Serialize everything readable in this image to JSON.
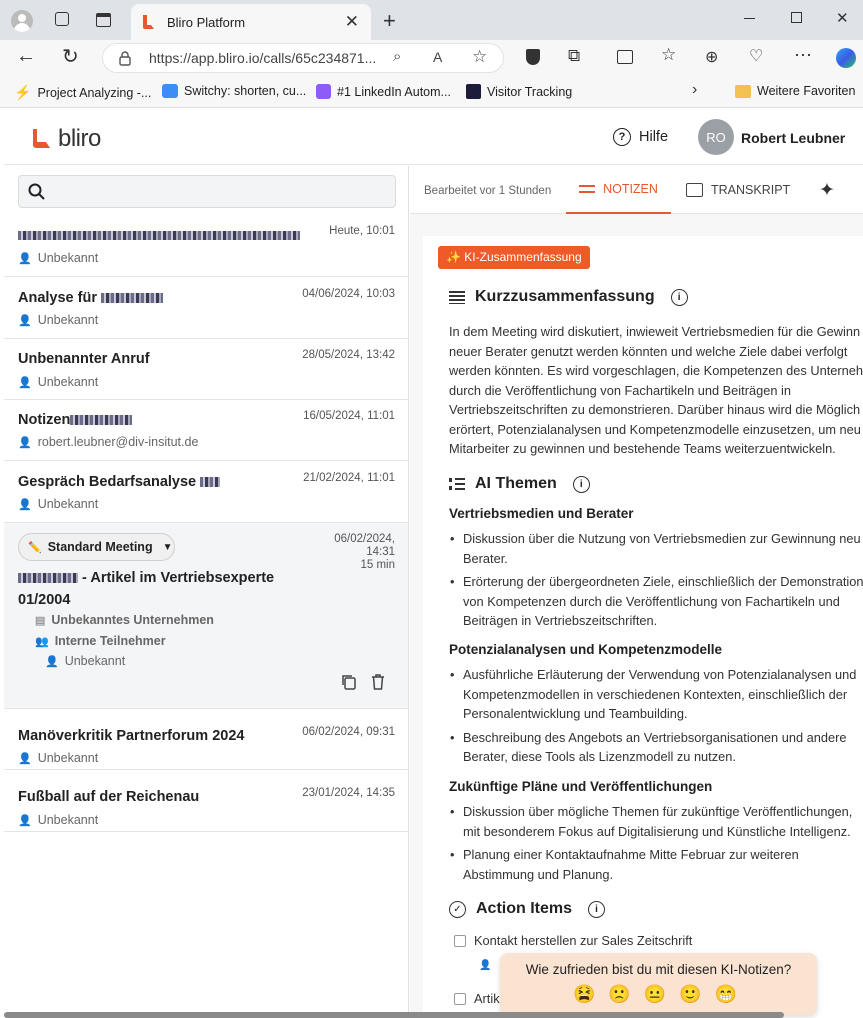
{
  "browser": {
    "tab_title": "Bliro Platform",
    "url": "https://app.bliro.io/calls/65c234871...",
    "bookmarks": [
      "Project Analyzing -...",
      "Switchy: shorten, cu...",
      "#1 LinkedIn Autom...",
      "Visitor Tracking",
      "Weitere Favoriten"
    ]
  },
  "header": {
    "logo": "bliro",
    "help": "Hilfe",
    "avatar_initials": "RO",
    "user_name": "Robert Leubner"
  },
  "calls": [
    {
      "title": "",
      "date": "Heute, 10:01",
      "sub": "Unbekannt"
    },
    {
      "title": "Analyse für",
      "date": "04/06/2024, 10:03",
      "sub": "Unbekannt"
    },
    {
      "title": "Unbenannter Anruf",
      "date": "28/05/2024, 13:42",
      "sub": "Unbekannt"
    },
    {
      "title": "Notizen",
      "date": "16/05/2024, 11:01",
      "sub": "robert.leubner@div-insitut.de"
    },
    {
      "title": "Gespräch Bedarfsanalyse",
      "date": "21/02/2024, 11:01",
      "sub": "Unbekannt"
    }
  ],
  "selected_call": {
    "meeting_type": "Standard Meeting",
    "date": "06/02/2024,",
    "time": "14:31",
    "duration": "15 min",
    "title_line1": "- Artikel im Vertriebsexperte",
    "title_line2": "01/2004",
    "company": "Unbekanntes Unternehmen",
    "participants_label": "Interne Teilnehmer",
    "participant": "Unbekannt"
  },
  "calls_after": [
    {
      "title": "Manöverkritik Partnerforum 2024",
      "date": "06/02/2024, 09:31",
      "sub": "Unbekannt"
    },
    {
      "title": "Fußball auf der Reichenau",
      "date": "23/01/2024, 14:35",
      "sub": "Unbekannt"
    }
  ],
  "notes_tabs": {
    "edited": "Bearbeitet vor 1 Stunden",
    "notes": "NOTIZEN",
    "transcript": "TRANSKRIPT"
  },
  "summary": {
    "badge": "✨ KI-Zusammenfassung",
    "kurz_title": "Kurzzusammenfassung",
    "kurz_lines": [
      "In dem Meeting wird diskutiert, inwieweit Vertriebsmedien für die Gewinn",
      "neuer Berater genutzt werden könnten und welche Ziele dabei verfolgt",
      "werden könnten. Es wird vorgeschlagen, die Kompetenzen des Unternehm",
      "durch die Veröffentlichung von Fachartikeln und Beiträgen in",
      "Vertriebszeitschriften zu demonstrieren. Darüber hinaus wird die Möglich",
      "erörtert, Potenzialanalysen und Kompetenzmodelle einzusetzen, um neu",
      "Mitarbeiter zu gewinnen und bestehende Teams weiterzuentwickeln."
    ],
    "themen_title": "AI Themen",
    "topics": [
      {
        "heading": "Vertriebsmedien und Berater",
        "bullets": [
          [
            "Diskussion über die Nutzung von Vertriebsmedien zur Gewinnung neu",
            "Berater."
          ],
          [
            "Erörterung der übergeordneten Ziele, einschließlich der Demonstration",
            "von Kompetenzen durch die Veröffentlichung von Fachartikeln und",
            "Beiträgen in Vertriebszeitschriften."
          ]
        ]
      },
      {
        "heading": "Potenzialanalysen und Kompetenzmodelle",
        "bullets": [
          [
            "Ausführliche Erläuterung der Verwendung von Potenzialanalysen und",
            "Kompetenzmodellen in verschiedenen Kontexten, einschließlich der",
            "Personalentwicklung und Teambuilding."
          ],
          [
            "Beschreibung des Angebots an Vertriebsorganisationen und andere",
            "Berater, diese Tools als Lizenzmodell zu nutzen."
          ]
        ]
      },
      {
        "heading": "Zukünftige Pläne und Veröffentlichungen",
        "bullets": [
          [
            "Diskussion über mögliche Themen für zukünftige Veröffentlichungen,",
            "mit besonderem Fokus auf Digitalisierung und Künstliche Intelligenz."
          ],
          [
            "Planung einer Kontaktaufnahme Mitte Februar zur weiteren",
            "Abstimmung und Planung."
          ]
        ]
      }
    ],
    "action_title": "Action Items",
    "action_items": [
      "Kontakt herstellen zur Sales Zeitschrift",
      "Artik"
    ],
    "action_owner": "R"
  },
  "feedback": {
    "question": "Wie zufrieden bist du mit diesen KI-Notizen?",
    "emojis": [
      "😫",
      "🙁",
      "😐",
      "🙂",
      "😁"
    ]
  },
  "colors": {
    "accent": "#e8582b",
    "badge_bg": "#ee5a2a",
    "toast_bg": "#fbe3d2"
  }
}
